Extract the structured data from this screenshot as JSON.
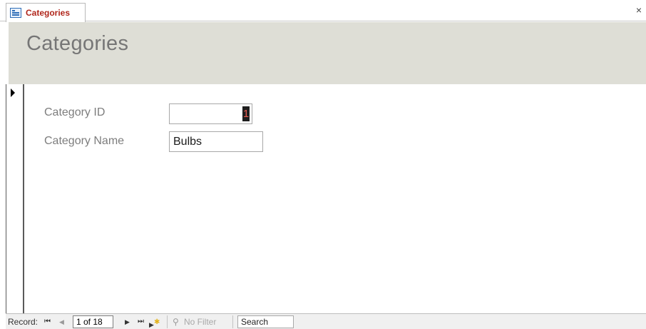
{
  "tab": {
    "title": "Categories",
    "icon": "form-icon",
    "close": "×"
  },
  "header": {
    "title": "Categories",
    "background": "#deded6"
  },
  "fields": [
    {
      "label": "Category ID",
      "value": "1"
    },
    {
      "label": "Category Name",
      "value": "Bulbs"
    }
  ],
  "navigation": {
    "label": "Record:",
    "first": "⏮",
    "previous": "◀",
    "current": "1 of 18",
    "next": "▶",
    "last": "⏭",
    "new_record": "new-record-icon",
    "filter": "No Filter",
    "search": "Search"
  }
}
